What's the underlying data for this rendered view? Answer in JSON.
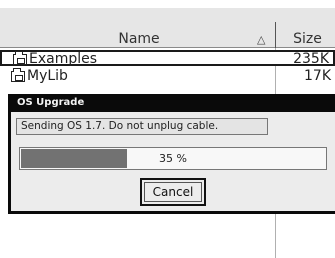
{
  "file_browser": {
    "columns": {
      "name": "Name",
      "size": "Size",
      "sort_indicator": "△"
    },
    "rows": [
      {
        "name": "Examples",
        "size": "235K",
        "icon": "folder-icon",
        "selected": true
      },
      {
        "name": "MyLib",
        "size": "17K",
        "icon": "folder-icon",
        "selected": false
      }
    ]
  },
  "dialog": {
    "title": "OS Upgrade",
    "message": "Sending OS 1.7. Do not unplug cable.",
    "progress": {
      "percent": 35,
      "label": "35 %"
    },
    "cancel_label": "Cancel"
  }
}
